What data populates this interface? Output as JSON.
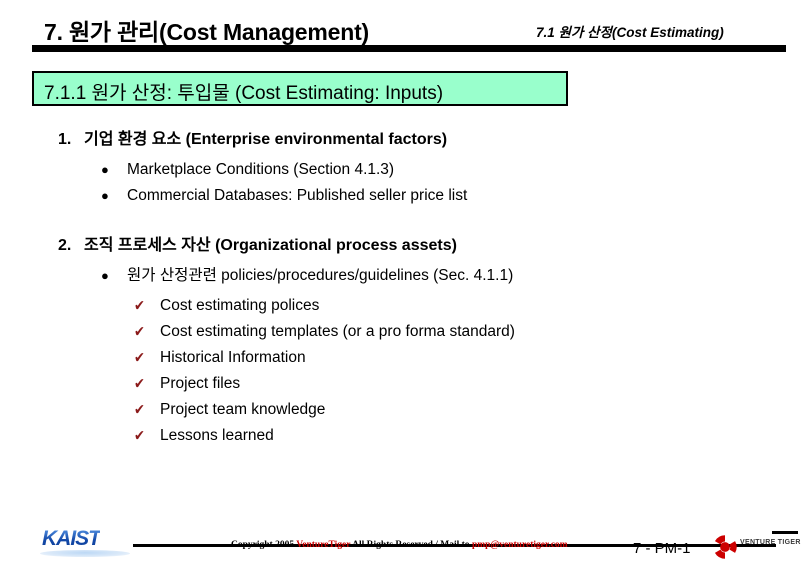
{
  "header": {
    "title": "7. 원가 관리(Cost Management)",
    "subtitle": "7.1 원가 산정(Cost Estimating)"
  },
  "section_box": {
    "label": "7.1.1 원가 산정: 투입물 (Cost Estimating: Inputs)",
    "fill_color": "#99FFCC",
    "border_color": "#000000"
  },
  "content": {
    "items": [
      {
        "number": "1.",
        "heading": "기업 환경 요소 (Enterprise environmental factors)",
        "bullets": [
          {
            "marker": "filled-circle-bullet",
            "text": "Marketplace Conditions (Section 4.1.3)"
          },
          {
            "marker": "filled-circle-bullet",
            "text": "Commercial Databases: Published seller price list"
          }
        ]
      },
      {
        "number": "2.",
        "heading": "조직 프로세스 자산 (Organizational process assets)",
        "bullets": [
          {
            "marker": "filled-circle-bullet",
            "text": "원가 산정관련 policies/procedures/guidelines (Sec. 4.1.1)",
            "sub_bullets": [
              {
                "marker": "wingding-check-bullet",
                "text": "Cost estimating polices"
              },
              {
                "marker": "wingding-check-bullet",
                "text": "Cost estimating templates (or a pro forma standard)"
              },
              {
                "marker": "wingding-check-bullet",
                "text": "Historical Information"
              },
              {
                "marker": "wingding-check-bullet",
                "text": "Project files"
              },
              {
                "marker": "wingding-check-bullet",
                "text": "Project team knowledge"
              },
              {
                "marker": "wingding-check-bullet",
                "text": "Lessons learned"
              }
            ]
          }
        ]
      }
    ]
  },
  "footer": {
    "kaist_logo_text": "KAIST",
    "copyright_prefix": "Copyright 2005 ",
    "copyright_brand": "VentureTiger",
    "copyright_middle": " All Rights Reserved / Mail to ",
    "copyright_mail": "pmp@venturetiger.com",
    "page_number": "7 - PM-1",
    "venture_logo_text": "VENTURE TIGER",
    "brand_color": "#CC0000",
    "kaist_color": "#1348a8"
  },
  "bullet_glyphs": {
    "filled_circle": "●",
    "wingding_check": "✔"
  }
}
